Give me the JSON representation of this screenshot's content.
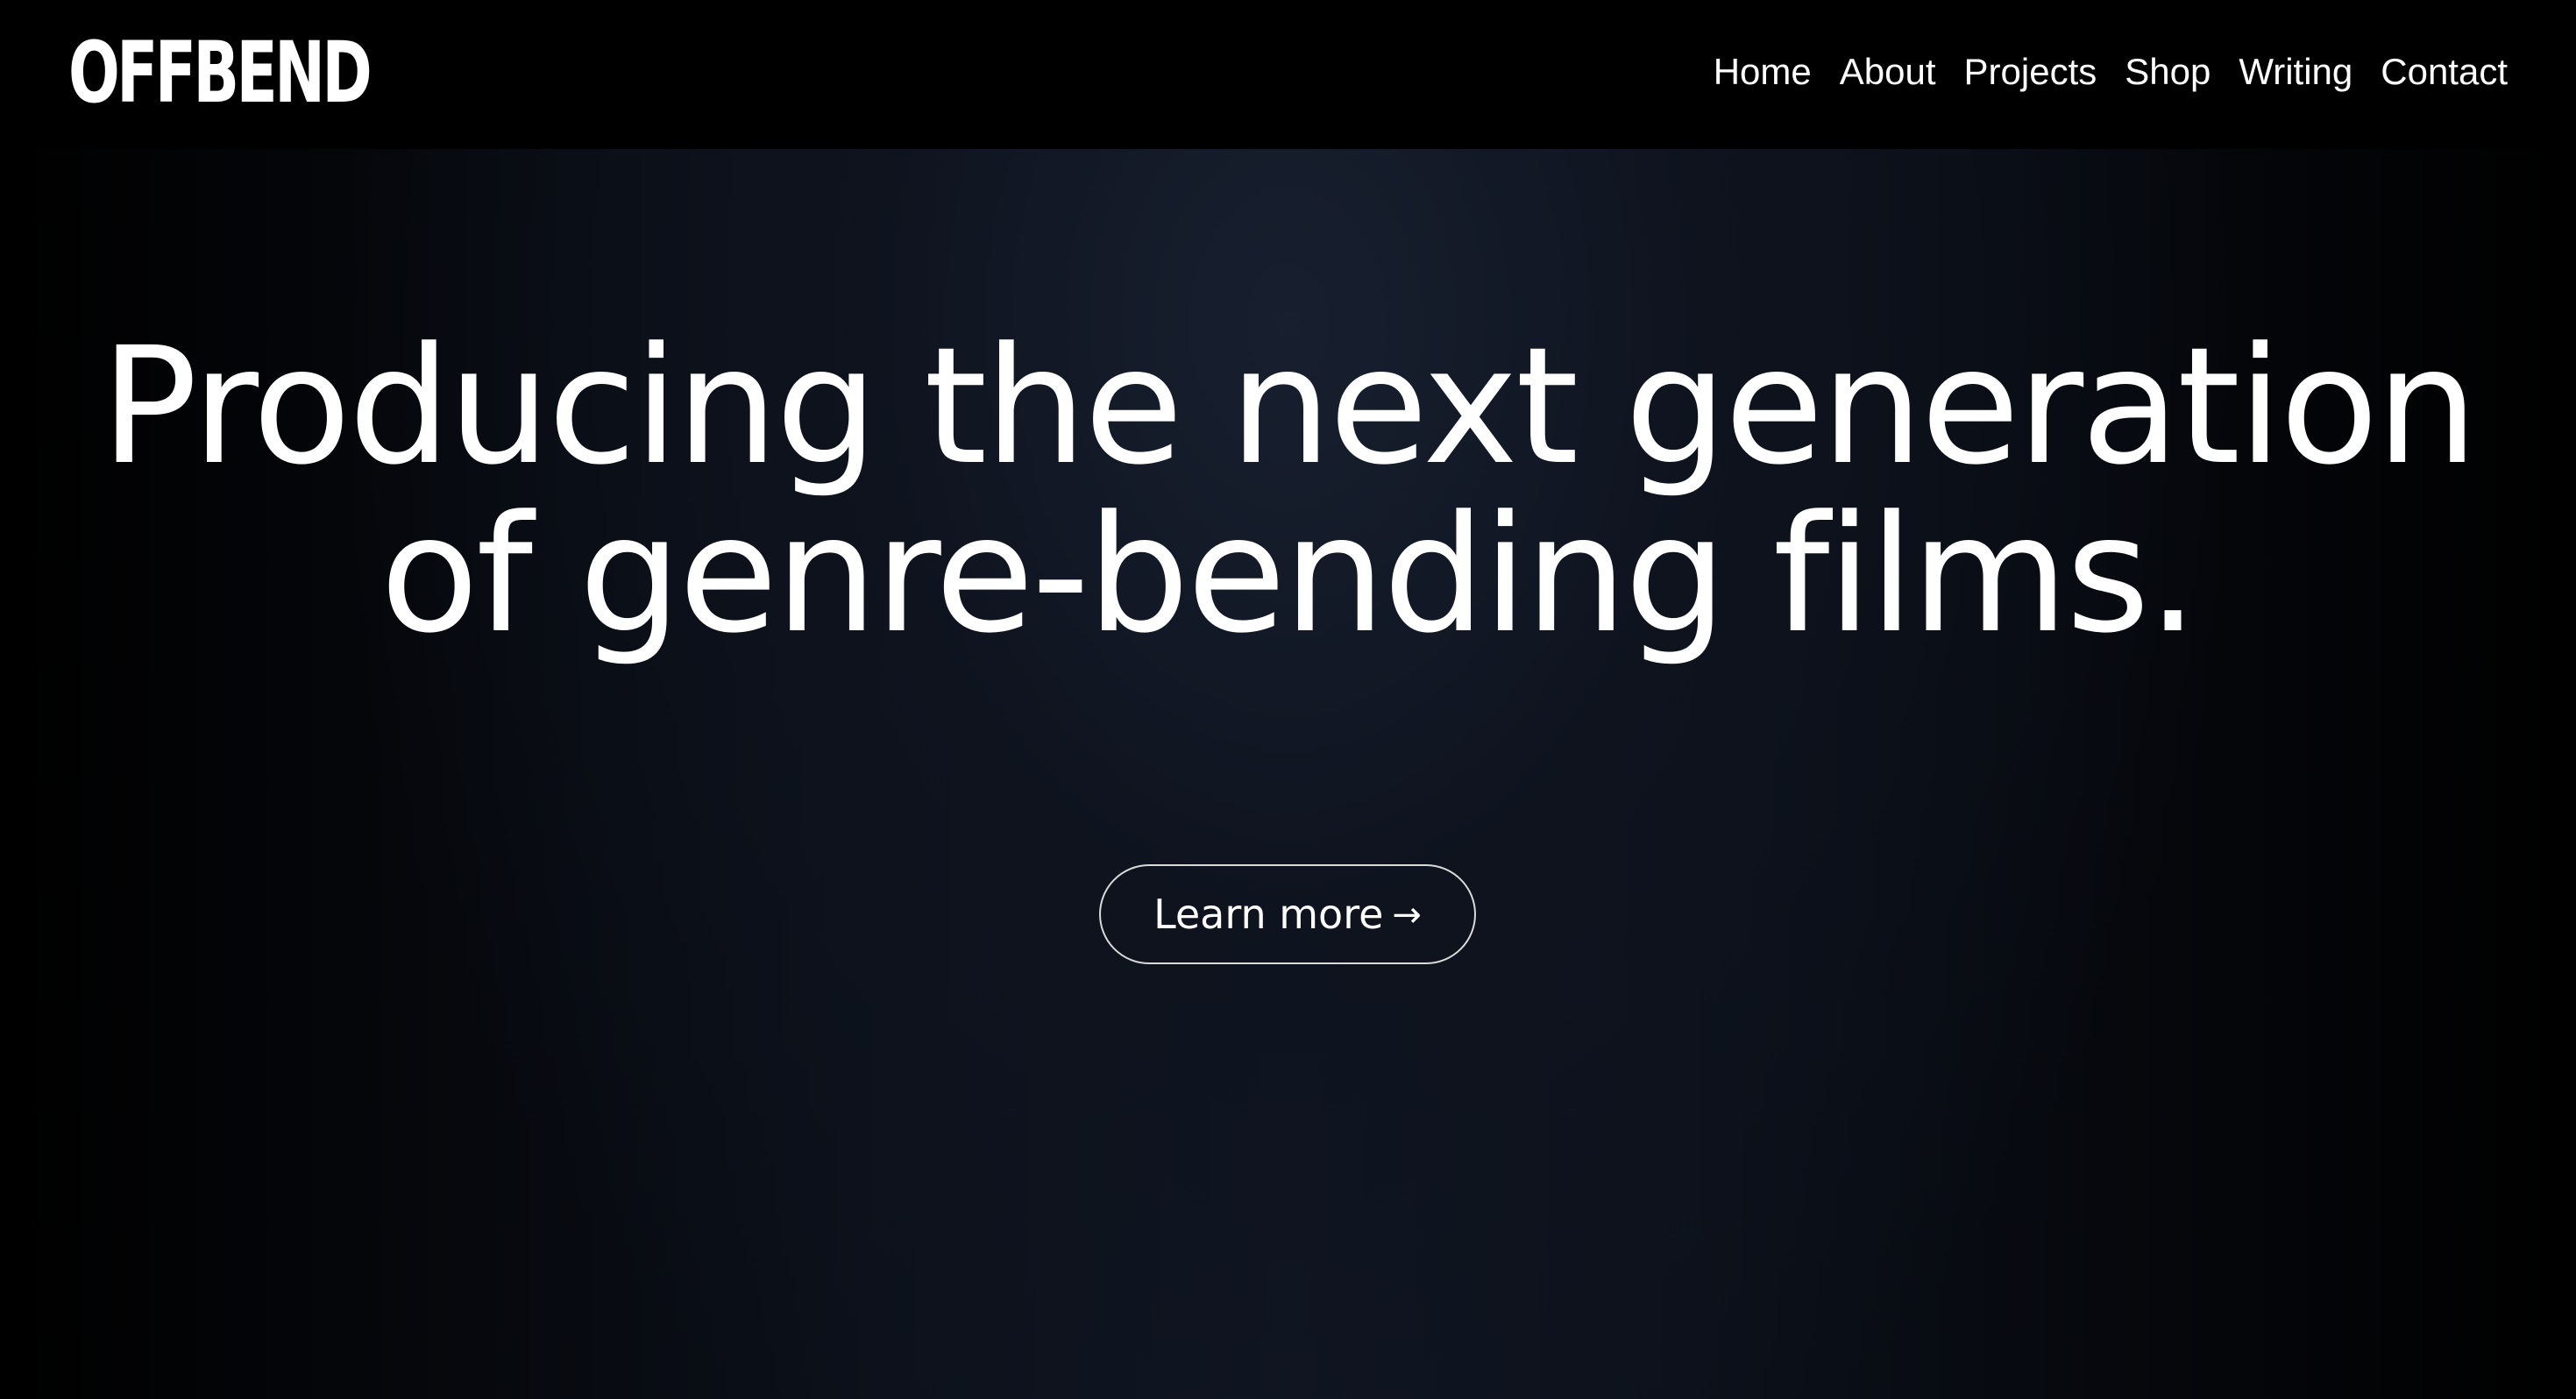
{
  "header": {
    "logo_text": "OFFBEND",
    "nav": [
      {
        "label": "Home"
      },
      {
        "label": "About"
      },
      {
        "label": "Projects"
      },
      {
        "label": "Shop"
      },
      {
        "label": "Writing"
      },
      {
        "label": "Contact"
      }
    ]
  },
  "hero": {
    "headline_line1": "Producing the next generation",
    "headline_line2": "of genre-bending films.",
    "cta_label": "Learn more",
    "cta_icon": "arrow-right-icon",
    "cta_arrow_glyph": "→"
  },
  "colors": {
    "background": "#000000",
    "hero_center": "#101623",
    "text": "#ffffff",
    "button_border": "#d9d9d9"
  }
}
